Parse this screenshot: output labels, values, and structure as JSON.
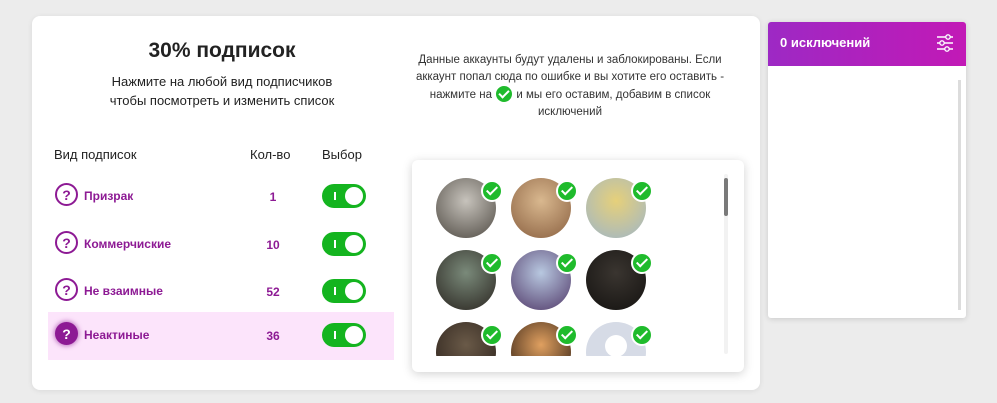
{
  "card": {
    "title": "30% подписок",
    "subtitle": "Нажмите на любой вид подписчиков чтобы посмотреть и изменить список",
    "notice_before": "Данные аккаунты будут удалены и заблокированы. Если аккаунт попал сюда по ошибке и вы хотите его оставить - нажмите на",
    "notice_after": "и мы его оставим, добавим в список исключений"
  },
  "table": {
    "headers": {
      "type": "Вид подписок",
      "count": "Кол-во",
      "choice": "Выбор"
    },
    "rows": [
      {
        "label": "Призрак",
        "count": "1",
        "enabled": true,
        "active": false
      },
      {
        "label": "Коммерчиские",
        "count": "10",
        "enabled": true,
        "active": false
      },
      {
        "label": "Не взаимные",
        "count": "52",
        "enabled": true,
        "active": false
      },
      {
        "label": "Неактиные",
        "count": "36",
        "enabled": true,
        "active": true
      }
    ],
    "icon": "help-question-icon",
    "icon_glyph": "?"
  },
  "gallery": {
    "avatars": [
      {
        "icon": "user-photo",
        "colors": [
          "#c7c3bc",
          "#4f4a43"
        ],
        "selected": true
      },
      {
        "icon": "user-photo",
        "colors": [
          "#d9b88f",
          "#8a6040"
        ],
        "selected": true
      },
      {
        "icon": "user-photo",
        "colors": [
          "#e6d07a",
          "#9fb6c8"
        ],
        "selected": true
      },
      {
        "icon": "user-photo",
        "colors": [
          "#7a8a7a",
          "#2a2520"
        ],
        "selected": true
      },
      {
        "icon": "user-photo",
        "colors": [
          "#b8c8e0",
          "#503868"
        ],
        "selected": true
      },
      {
        "icon": "user-photo",
        "colors": [
          "#3a3530",
          "#141210"
        ],
        "selected": true
      },
      {
        "icon": "user-photo",
        "colors": [
          "#6a5a48",
          "#2a201a"
        ],
        "selected": true
      },
      {
        "icon": "user-photo",
        "colors": [
          "#e0a060",
          "#2a1a10"
        ],
        "selected": true
      },
      {
        "icon": "default-avatar",
        "colors": [
          "#d6dbe6",
          "#aab3c6"
        ],
        "selected": true
      }
    ]
  },
  "side_panel": {
    "title": "0 исключений",
    "icon": "filter-sliders-icon"
  },
  "colors": {
    "accent": "#8d1a94",
    "toggle_on": "#14b41f",
    "check": "#1fbb2c",
    "active_row": "#fce4fb",
    "header_gradient_start": "#9d29c4",
    "header_gradient_end": "#c219b6"
  }
}
